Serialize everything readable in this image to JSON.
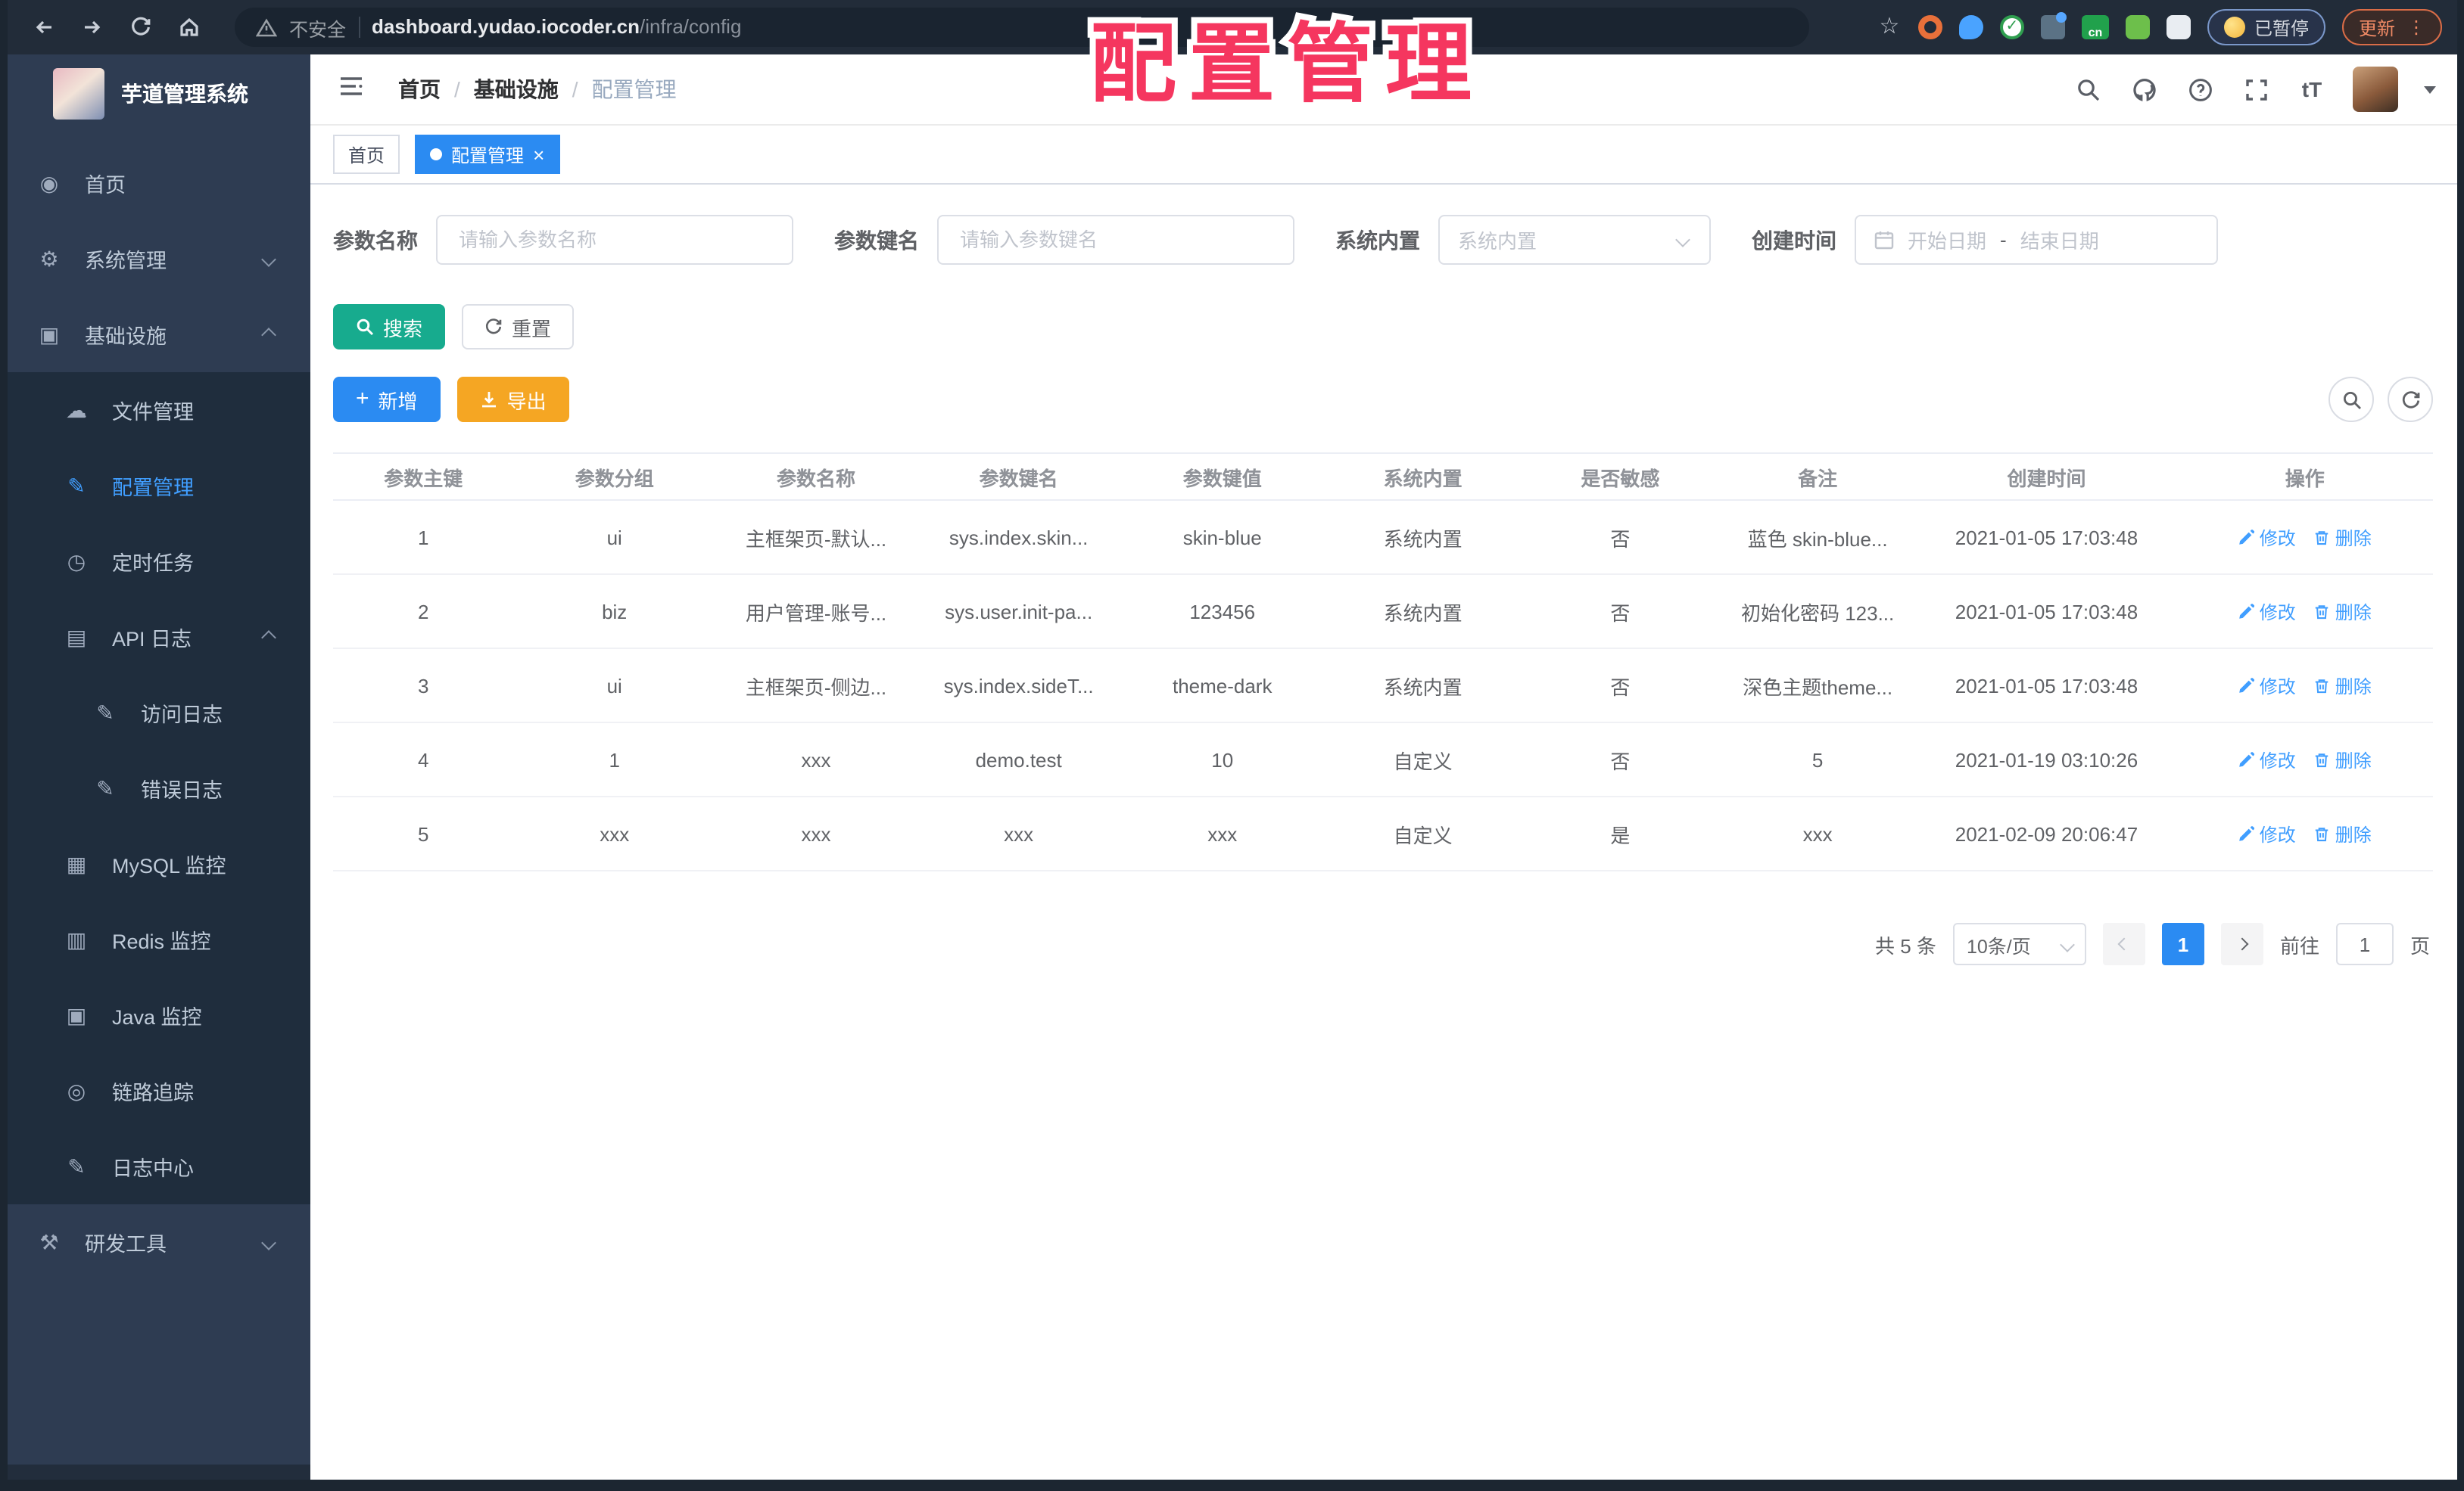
{
  "theme": {
    "primary": "#2b8bf2",
    "link_blue": "#409eff",
    "search_teal": "#17ab8e",
    "export_orange": "#f5a623",
    "sidebar_bg": "#2e3c52",
    "submenu_bg": "#1f2d3d",
    "browser_bar_bg": "#222c39",
    "annotation_color": "#f5365f"
  },
  "browser": {
    "security_label": "不安全",
    "url_host": "dashboard.yudao.iocoder.cn",
    "url_path": "/infra/config",
    "cn_badge": "cn",
    "paused_label": "已暂停",
    "update_label": "更新",
    "menu_dots": "⋮"
  },
  "sidebar": {
    "title": "芋道管理系统",
    "items": [
      {
        "label": "首页",
        "glyph": "◉",
        "icon": "dashboard-icon",
        "level": 1
      },
      {
        "label": "系统管理",
        "glyph": "⚙",
        "icon": "gear-icon",
        "level": 1,
        "chevron": "down"
      },
      {
        "label": "基础设施",
        "glyph": "▣",
        "icon": "infrastructure-icon",
        "level": 1,
        "chevron": "up"
      },
      {
        "label": "文件管理",
        "glyph": "☁",
        "icon": "cloud-icon",
        "level": 2
      },
      {
        "label": "配置管理",
        "glyph": "✎",
        "icon": "edit-icon",
        "level": 2,
        "active": true
      },
      {
        "label": "定时任务",
        "glyph": "◷",
        "icon": "timer-icon",
        "level": 2
      },
      {
        "label": "API 日志",
        "glyph": "▤",
        "icon": "api-log-icon",
        "level": 2,
        "chevron": "up"
      },
      {
        "label": "访问日志",
        "glyph": "✎",
        "icon": "access-log-icon",
        "level": 3
      },
      {
        "label": "错误日志",
        "glyph": "✎",
        "icon": "error-log-icon",
        "level": 3
      },
      {
        "label": "MySQL 监控",
        "glyph": "▦",
        "icon": "mysql-monitor-icon",
        "level": 2
      },
      {
        "label": "Redis 监控",
        "glyph": "▥",
        "icon": "redis-monitor-icon",
        "level": 2
      },
      {
        "label": "Java 监控",
        "glyph": "▣",
        "icon": "java-monitor-icon",
        "level": 2
      },
      {
        "label": "链路追踪",
        "glyph": "◎",
        "icon": "trace-eye-icon",
        "level": 2
      },
      {
        "label": "日志中心",
        "glyph": "✎",
        "icon": "log-center-icon",
        "level": 2
      },
      {
        "label": "研发工具",
        "glyph": "⚒",
        "icon": "devtools-icon",
        "level": 1,
        "chevron": "down"
      }
    ]
  },
  "header": {
    "breadcrumb": [
      "首页",
      "基础设施",
      "配置管理"
    ],
    "separator": "/"
  },
  "tabs": [
    {
      "label": "首页"
    },
    {
      "label": "配置管理",
      "active": true,
      "close": "×"
    }
  ],
  "annotation": {
    "text": "配置管理"
  },
  "filters": {
    "name": {
      "label": "参数名称",
      "placeholder": "请输入参数名称"
    },
    "key": {
      "label": "参数键名",
      "placeholder": "请输入参数键名"
    },
    "builtin": {
      "label": "系统内置",
      "placeholder": "系统内置"
    },
    "time": {
      "label": "创建时间",
      "start_placeholder": "开始日期",
      "separator": "-",
      "end_placeholder": "结束日期"
    }
  },
  "actions": {
    "search": "搜索",
    "reset": "重置",
    "add": "新增",
    "export": "导出"
  },
  "table": {
    "columns": [
      "参数主键",
      "参数分组",
      "参数名称",
      "参数键名",
      "参数键值",
      "系统内置",
      "是否敏感",
      "备注",
      "创建时间",
      "操作"
    ],
    "rows": [
      [
        "1",
        "ui",
        "主框架页-默认...",
        "sys.index.skin...",
        "skin-blue",
        "系统内置",
        "否",
        "蓝色 skin-blue...",
        "2021-01-05 17:03:48"
      ],
      [
        "2",
        "biz",
        "用户管理-账号...",
        "sys.user.init-pa...",
        "123456",
        "系统内置",
        "否",
        "初始化密码 123...",
        "2021-01-05 17:03:48"
      ],
      [
        "3",
        "ui",
        "主框架页-侧边...",
        "sys.index.sideT...",
        "theme-dark",
        "系统内置",
        "否",
        "深色主题theme...",
        "2021-01-05 17:03:48"
      ],
      [
        "4",
        "1",
        "xxx",
        "demo.test",
        "10",
        "自定义",
        "否",
        "5",
        "2021-01-19 03:10:26"
      ],
      [
        "5",
        "xxx",
        "xxx",
        "xxx",
        "xxx",
        "自定义",
        "是",
        "xxx",
        "2021-02-09 20:06:47"
      ]
    ],
    "edit_label": "修改",
    "delete_label": "删除"
  },
  "pagination": {
    "total_label": "共 5 条",
    "page_size": "10条/页",
    "current": "1",
    "goto_label": "前往",
    "page_unit": "页",
    "goto_value": "1"
  }
}
